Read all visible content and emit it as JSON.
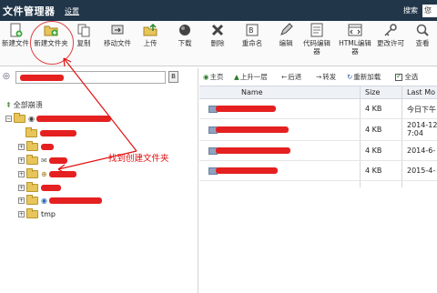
{
  "titlebar": {
    "title": "文件管理器",
    "settings_link": "设置",
    "search_label": "搜索",
    "search_value": "您"
  },
  "toolbar": {
    "items": [
      {
        "label": "新建文件",
        "icon": "new-file-icon"
      },
      {
        "label": "新建文件夹",
        "icon": "new-folder-icon"
      },
      {
        "label": "复制",
        "icon": "copy-icon"
      },
      {
        "label": "移动文件",
        "icon": "move-file-icon"
      },
      {
        "label": "上传",
        "icon": "upload-icon"
      },
      {
        "label": "下载",
        "icon": "download-icon"
      },
      {
        "label": "删除",
        "icon": "delete-icon"
      },
      {
        "label": "重命名",
        "icon": "rename-icon"
      },
      {
        "label": "编辑",
        "icon": "edit-icon"
      },
      {
        "label": "代码编辑器",
        "icon": "code-editor-icon"
      },
      {
        "label": "HTML编辑器",
        "icon": "html-editor-icon"
      },
      {
        "label": "更改许可",
        "icon": "change-permissions-icon"
      },
      {
        "label": "查看",
        "icon": "view-icon"
      }
    ]
  },
  "left_pane": {
    "go_button": "B",
    "collapse_all": "全部崩溃",
    "tree": [
      {
        "name": ""
      },
      {
        "name": ""
      },
      {
        "name": ""
      },
      {
        "name": ""
      },
      {
        "name": ""
      },
      {
        "name": ""
      },
      {
        "name": ""
      },
      {
        "name": "tmp"
      }
    ]
  },
  "annotation": {
    "text": "找到创建文件夹",
    "color": "#e01010"
  },
  "right_pane": {
    "nav": {
      "home": "主页",
      "up_one_level": "上升一层",
      "back": "后退",
      "forward": "转发",
      "reload": "重新加载",
      "select_all": "全选"
    },
    "columns": [
      "Name",
      "Size",
      "Last Mo"
    ],
    "rows": [
      {
        "size": "4 KB",
        "modified": "今日下午"
      },
      {
        "size": "4 KB",
        "modified": "2014-12\n7:04"
      },
      {
        "size": "4 KB",
        "modified": "2014-6-"
      },
      {
        "size": "4 KB",
        "modified": "2015-4-"
      }
    ]
  },
  "colors": {
    "titlebar_bg": "#22364a",
    "redaction": "#e52020",
    "highlight_ring": "#e04040"
  }
}
